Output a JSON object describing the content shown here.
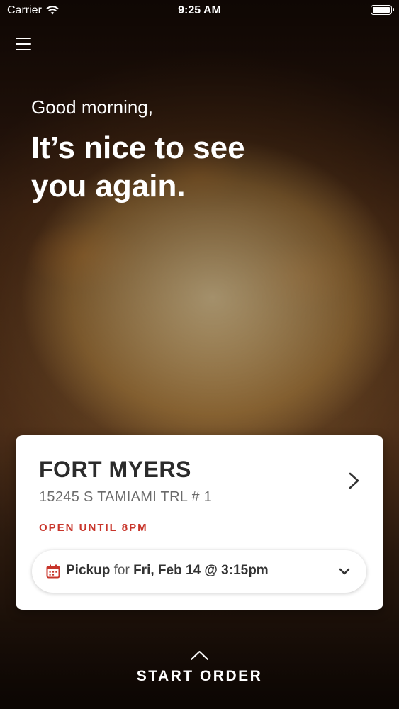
{
  "status_bar": {
    "carrier": "Carrier",
    "time": "9:25 AM"
  },
  "hero": {
    "greeting": "Good morning,",
    "headline": "It’s nice to see you again."
  },
  "location": {
    "name": "FORT MYERS",
    "address": "15245 S TAMIAMI TRL # 1",
    "status": "OPEN UNTIL 8PM"
  },
  "pickup": {
    "mode": "Pickup",
    "connector": "for",
    "datetime": "Fri, Feb 14 @ 3:15pm"
  },
  "cta": {
    "label": "START ORDER"
  },
  "colors": {
    "accent_red": "#c8352b",
    "text_dark": "#2b2b2b",
    "text_muted": "#6b6b6b"
  },
  "icons": [
    "wifi-icon",
    "battery-icon",
    "menu-icon",
    "chevron-right-icon",
    "calendar-icon",
    "chevron-down-icon",
    "chevron-up-icon"
  ]
}
